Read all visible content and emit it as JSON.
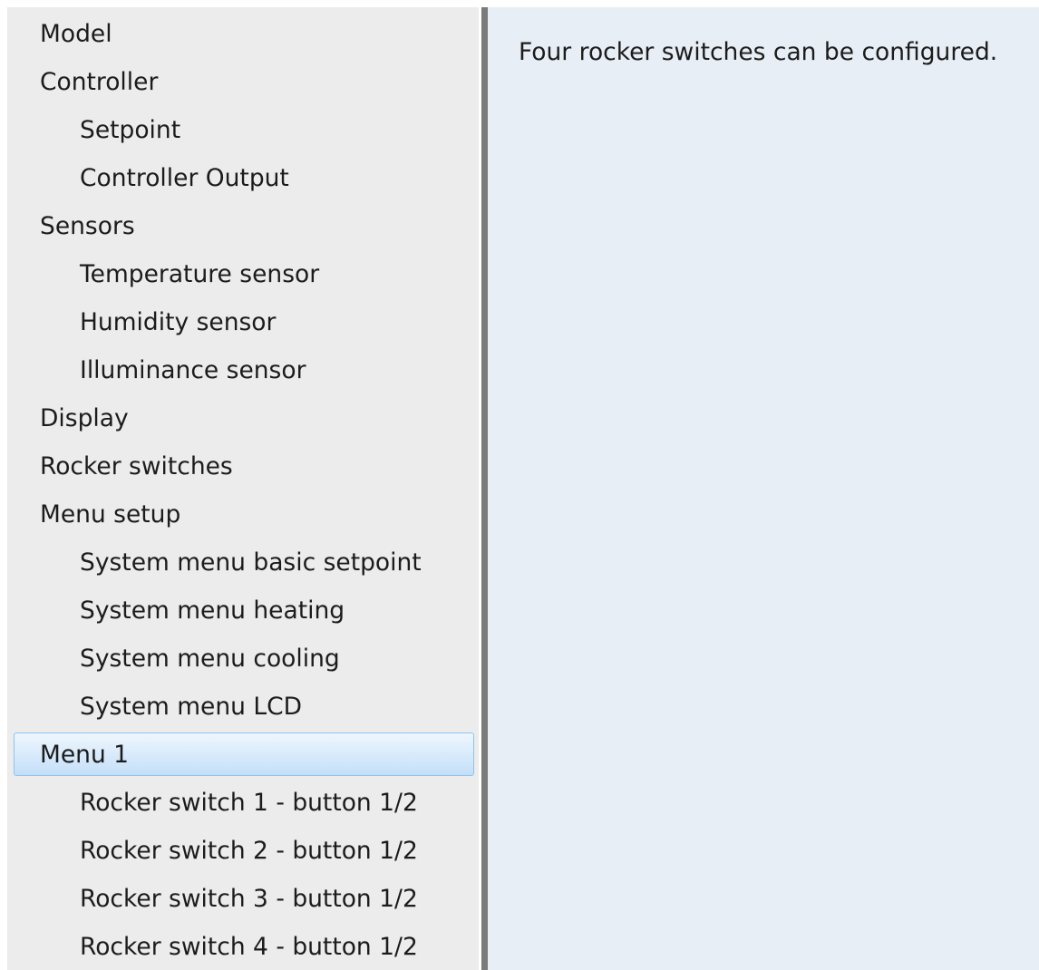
{
  "sidebar": {
    "items": [
      {
        "label": "Model",
        "level": 1
      },
      {
        "label": "Controller",
        "level": 1
      },
      {
        "label": "Setpoint",
        "level": 2
      },
      {
        "label": "Controller Output",
        "level": 2
      },
      {
        "label": "Sensors",
        "level": 1
      },
      {
        "label": "Temperature sensor",
        "level": 2
      },
      {
        "label": "Humidity sensor",
        "level": 2
      },
      {
        "label": "Illuminance sensor",
        "level": 2
      },
      {
        "label": "Display",
        "level": 1
      },
      {
        "label": "Rocker switches",
        "level": 1
      },
      {
        "label": "Menu setup",
        "level": 1
      },
      {
        "label": "System menu basic setpoint",
        "level": 2
      },
      {
        "label": "System menu heating",
        "level": 2
      },
      {
        "label": "System menu cooling",
        "level": 2
      },
      {
        "label": "System menu LCD",
        "level": 2
      },
      {
        "label": "Menu 1",
        "level": 1,
        "selected": true
      },
      {
        "label": "Rocker switch 1 - button 1/2",
        "level": 2
      },
      {
        "label": "Rocker switch 2 - button 1/2",
        "level": 2
      },
      {
        "label": "Rocker switch 3 - button 1/2",
        "level": 2
      },
      {
        "label": "Rocker switch 4 - button 1/2",
        "level": 2
      }
    ]
  },
  "content": {
    "description": "Four rocker switches can be configured."
  },
  "colors": {
    "sidebar_background": "#ececec",
    "content_background": "#e8eef5",
    "selection_border": "#8ec3ef",
    "selection_fill": "#d7eafb",
    "splitter": "#7a7a7a",
    "text": "#1c1c1c"
  }
}
